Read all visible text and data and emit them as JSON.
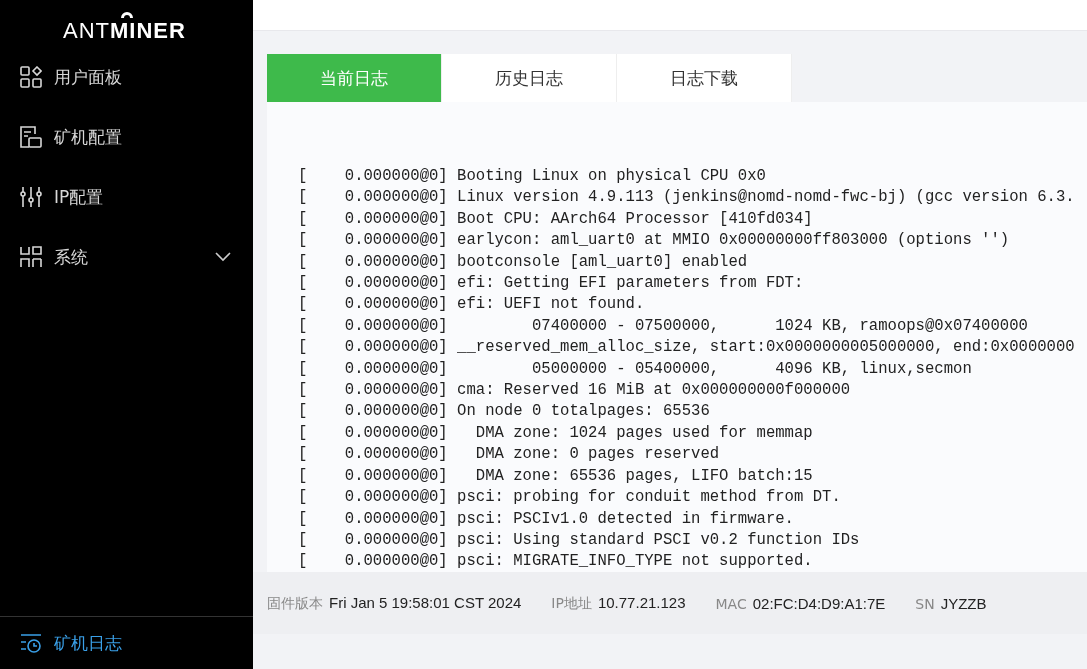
{
  "logo": "ANT**MINER**",
  "nav": [
    {
      "label": "用户面板",
      "kind": "grid",
      "selected": false,
      "has_submenu": false
    },
    {
      "label": "矿机配置",
      "kind": "panel",
      "selected": false,
      "has_submenu": false
    },
    {
      "label": "IP配置",
      "kind": "sliders",
      "selected": false,
      "has_submenu": false
    },
    {
      "label": "系统",
      "kind": "network",
      "selected": false,
      "has_submenu": true
    }
  ],
  "nav_footer": {
    "label": "矿机日志",
    "kind": "log",
    "selected": true
  },
  "tabs": [
    {
      "label": "当前日志",
      "selected": true
    },
    {
      "label": "历史日志",
      "selected": false
    },
    {
      "label": "日志下载",
      "selected": false
    }
  ],
  "log_lines": [
    "[    0.000000@0] Booting Linux on physical CPU 0x0",
    "[    0.000000@0] Linux version 4.9.113 (jenkins@nomd-nomd-fwc-bj) (gcc version 6.3.",
    "[    0.000000@0] Boot CPU: AArch64 Processor [410fd034]",
    "[    0.000000@0] earlycon: aml_uart0 at MMIO 0x00000000ff803000 (options '')",
    "[    0.000000@0] bootconsole [aml_uart0] enabled",
    "[    0.000000@0] efi: Getting EFI parameters from FDT:",
    "[    0.000000@0] efi: UEFI not found.",
    "[    0.000000@0]         07400000 - 07500000,      1024 KB, ramoops@0x07400000",
    "[    0.000000@0] __reserved_mem_alloc_size, start:0x0000000005000000, end:0x0000000",
    "[    0.000000@0]         05000000 - 05400000,      4096 KB, linux,secmon",
    "[    0.000000@0] cma: Reserved 16 MiB at 0x000000000f000000",
    "[    0.000000@0] On node 0 totalpages: 65536",
    "[    0.000000@0]   DMA zone: 1024 pages used for memmap",
    "[    0.000000@0]   DMA zone: 0 pages reserved",
    "[    0.000000@0]   DMA zone: 65536 pages, LIFO batch:15",
    "[    0.000000@0] psci: probing for conduit method from DT.",
    "[    0.000000@0] psci: PSCIv1.0 detected in firmware.",
    "[    0.000000@0] psci: Using standard PSCI v0.2 function IDs",
    "[    0.000000@0] psci: MIGRATE_INFO_TYPE not supported."
  ],
  "status_bar": [
    {
      "label": "固件版本",
      "value": "Fri Jan 5 19:58:01 CST 2024"
    },
    {
      "label": "IP地址",
      "value": "10.77.21.123"
    },
    {
      "label": "MAC",
      "value": "02:FC:D4:D9:A1:7E"
    },
    {
      "label": "SN",
      "value": "JYZZB"
    }
  ]
}
